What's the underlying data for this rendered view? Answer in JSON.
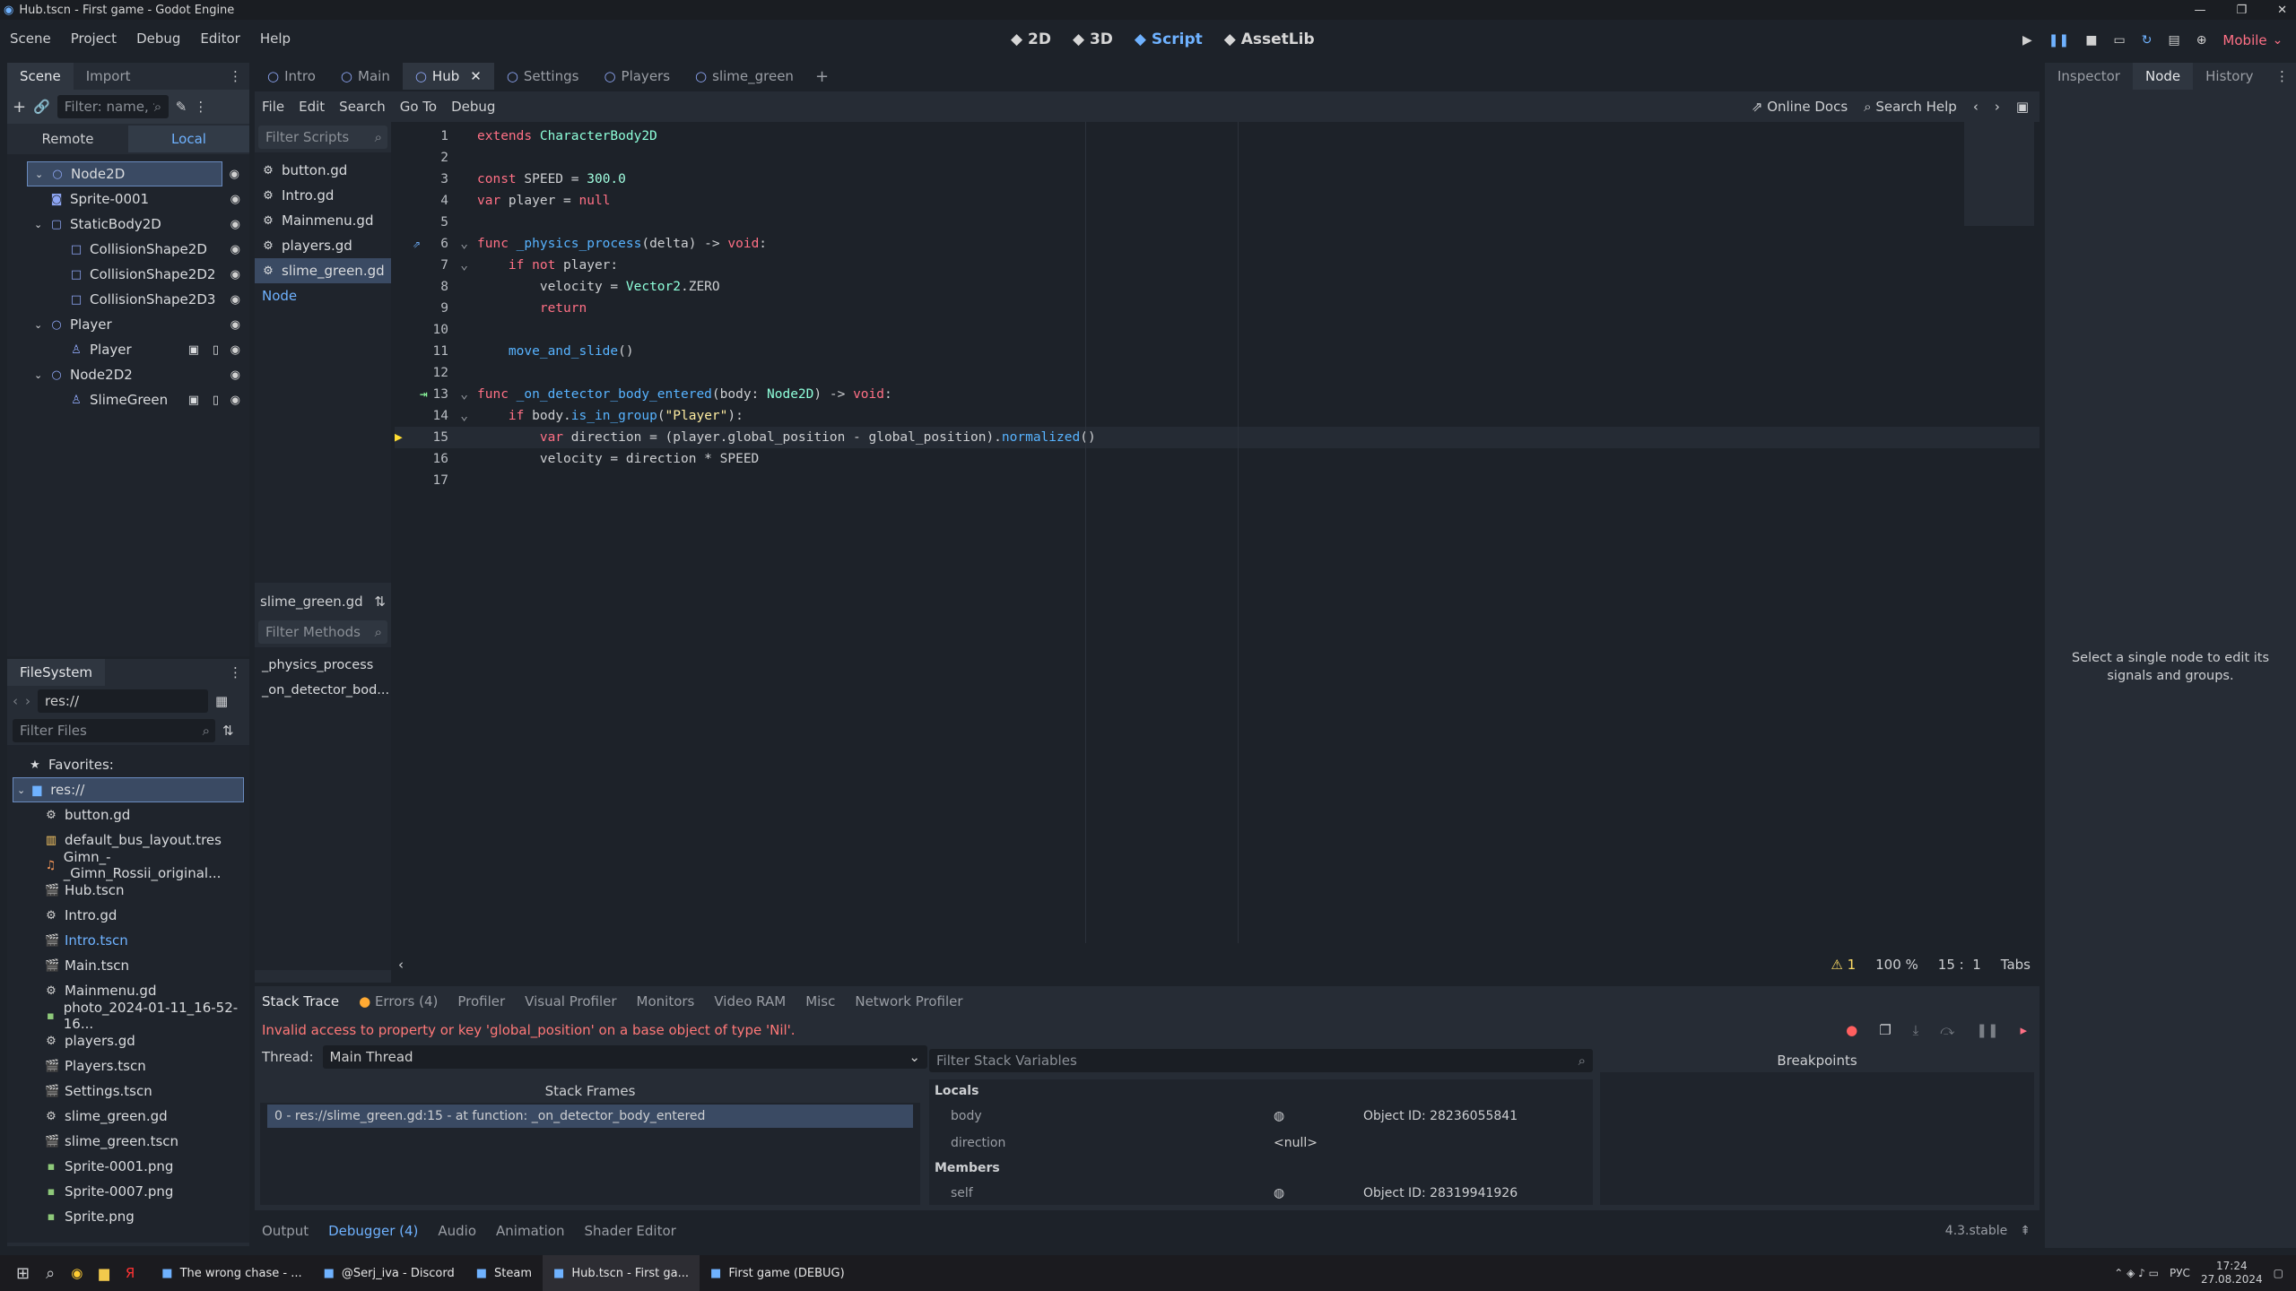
{
  "window": {
    "title": "Hub.tscn - First game - Godot Engine"
  },
  "menu": [
    "Scene",
    "Project",
    "Debug",
    "Editor",
    "Help"
  ],
  "workspaces": [
    {
      "icon": "2d-icon",
      "label": "2D"
    },
    {
      "icon": "3d-icon",
      "label": "3D"
    },
    {
      "icon": "script-icon",
      "label": "Script"
    },
    {
      "icon": "assetlib-icon",
      "label": "AssetLib"
    }
  ],
  "renderer": "Mobile",
  "scene_dock": {
    "tabs": [
      "Scene",
      "Import"
    ],
    "filter_placeholder": "Filter: name, t:t",
    "remote": "Remote",
    "local": "Local",
    "tree": [
      {
        "label": "Node2D",
        "depth": 0,
        "selected": true,
        "icon": "node2d-icon",
        "fold": true
      },
      {
        "label": "Sprite-0001",
        "depth": 1,
        "icon": "sprite-icon"
      },
      {
        "label": "StaticBody2D",
        "depth": 1,
        "icon": "staticbody-icon",
        "fold": true
      },
      {
        "label": "CollisionShape2D",
        "depth": 2,
        "icon": "collision-icon"
      },
      {
        "label": "CollisionShape2D2",
        "depth": 2,
        "icon": "collision-icon"
      },
      {
        "label": "CollisionShape2D3",
        "depth": 2,
        "icon": "collision-icon"
      },
      {
        "label": "Player",
        "depth": 1,
        "icon": "node2d-icon",
        "fold": true
      },
      {
        "label": "Player",
        "depth": 2,
        "icon": "player-icon",
        "extra": true
      },
      {
        "label": "Node2D2",
        "depth": 1,
        "icon": "node2d-icon",
        "fold": true
      },
      {
        "label": "SlimeGreen",
        "depth": 2,
        "icon": "player-icon",
        "extra": true
      }
    ]
  },
  "filesystem": {
    "title": "FileSystem",
    "path": "res://",
    "filter_placeholder": "Filter Files",
    "favorites": "Favorites:",
    "root": "res://",
    "files": [
      {
        "name": "button.gd",
        "icon": "gear-icon"
      },
      {
        "name": "default_bus_layout.tres",
        "icon": "resource-icon"
      },
      {
        "name": "Gimn_-_Gimn_Rossii_original...",
        "icon": "audio-icon"
      },
      {
        "name": "Hub.tscn",
        "icon": "scene-icon"
      },
      {
        "name": "Intro.gd",
        "icon": "gear-icon"
      },
      {
        "name": "Intro.tscn",
        "icon": "scene-icon",
        "highlight": true
      },
      {
        "name": "Main.tscn",
        "icon": "scene-icon"
      },
      {
        "name": "Mainmenu.gd",
        "icon": "gear-icon"
      },
      {
        "name": "photo_2024-01-11_16-52-16...",
        "icon": "image-icon"
      },
      {
        "name": "players.gd",
        "icon": "gear-icon"
      },
      {
        "name": "Players.tscn",
        "icon": "scene-icon"
      },
      {
        "name": "Settings.tscn",
        "icon": "scene-icon"
      },
      {
        "name": "slime_green.gd",
        "icon": "gear-icon"
      },
      {
        "name": "slime_green.tscn",
        "icon": "scene-icon"
      },
      {
        "name": "Sprite-0001.png",
        "icon": "image-icon"
      },
      {
        "name": "Sprite-0007.png",
        "icon": "image-icon"
      },
      {
        "name": "Sprite.png",
        "icon": "image-icon"
      }
    ]
  },
  "scene_tabs": [
    {
      "label": "Intro"
    },
    {
      "label": "Main"
    },
    {
      "label": "Hub",
      "active": true
    },
    {
      "label": "Settings"
    },
    {
      "label": "Players"
    },
    {
      "label": "slime_green"
    }
  ],
  "script_menu": [
    "File",
    "Edit",
    "Search",
    "Go To",
    "Debug"
  ],
  "online_docs": "Online Docs",
  "search_help": "Search Help",
  "scripts_list": {
    "filter_placeholder": "Filter Scripts",
    "items": [
      {
        "name": "button.gd"
      },
      {
        "name": "Intro.gd"
      },
      {
        "name": "Mainmenu.gd"
      },
      {
        "name": "players.gd"
      },
      {
        "name": "slime_green.gd",
        "selected": true
      },
      {
        "name": "Node",
        "link": true
      }
    ],
    "current": "slime_green.gd",
    "methods_placeholder": "Filter Methods",
    "methods": [
      "_physics_process",
      "_on_detector_bod..."
    ]
  },
  "code": [
    [
      {
        "t": "extends ",
        "c": "kw"
      },
      {
        "t": "CharacterBody2D",
        "c": "ty"
      }
    ],
    [],
    [
      {
        "t": "const ",
        "c": "kw"
      },
      {
        "t": "SPEED = "
      },
      {
        "t": "300.0",
        "c": "num"
      }
    ],
    [
      {
        "t": "var ",
        "c": "kw"
      },
      {
        "t": "player = "
      },
      {
        "t": "null",
        "c": "kw"
      }
    ],
    [],
    [
      {
        "t": "func ",
        "c": "kw"
      },
      {
        "t": "_physics_process",
        "c": "fn"
      },
      {
        "t": "(delta) -> "
      },
      {
        "t": "void",
        "c": "kw"
      },
      {
        "t": ":"
      }
    ],
    [
      {
        "t": "    "
      },
      {
        "t": "if not ",
        "c": "kw"
      },
      {
        "t": "player:"
      }
    ],
    [
      {
        "t": "        "
      },
      {
        "t": "velocity = "
      },
      {
        "t": "Vector2",
        "c": "ty"
      },
      {
        "t": ".ZERO"
      }
    ],
    [
      {
        "t": "        "
      },
      {
        "t": "return",
        "c": "kw"
      }
    ],
    [],
    [
      {
        "t": "    "
      },
      {
        "t": "move_and_slide",
        "c": "fn"
      },
      {
        "t": "()"
      }
    ],
    [],
    [
      {
        "t": "func ",
        "c": "kw"
      },
      {
        "t": "_on_detector_body_entered",
        "c": "fn"
      },
      {
        "t": "(body: "
      },
      {
        "t": "Node2D",
        "c": "ty"
      },
      {
        "t": ") -> "
      },
      {
        "t": "void",
        "c": "kw"
      },
      {
        "t": ":"
      }
    ],
    [
      {
        "t": "    "
      },
      {
        "t": "if ",
        "c": "kw"
      },
      {
        "t": "body."
      },
      {
        "t": "is_in_group",
        "c": "fn"
      },
      {
        "t": "("
      },
      {
        "t": "\"Player\"",
        "c": "str"
      },
      {
        "t": "):"
      }
    ],
    [
      {
        "t": "        "
      },
      {
        "t": "var ",
        "c": "kw"
      },
      {
        "t": "direction = (player.global_position - global_position)."
      },
      {
        "t": "normalized",
        "c": "fn"
      },
      {
        "t": "()"
      }
    ],
    [
      {
        "t": "        "
      },
      {
        "t": "velocity = direction * SPEED"
      }
    ],
    []
  ],
  "status": {
    "warnings": "1",
    "zoom": "100 %",
    "line": "15",
    "col": "1",
    "indent": "Tabs"
  },
  "debugger": {
    "tabs": [
      "Stack Trace",
      "Errors (4)",
      "Profiler",
      "Visual Profiler",
      "Monitors",
      "Video RAM",
      "Misc",
      "Network Profiler"
    ],
    "error": "Invalid access to property or key 'global_position' on a base object of type 'Nil'.",
    "thread_label": "Thread:",
    "thread": "Main Thread",
    "stack_title": "Stack Frames",
    "frame": "0 - res://slime_green.gd:15 - at function: _on_detector_body_entered",
    "filter_vars": "Filter Stack Variables",
    "breakpoints": "Breakpoints",
    "locals": "Locals",
    "members": "Members",
    "vars": [
      {
        "name": "body",
        "value": "Object ID: 28236055841",
        "obj": true
      },
      {
        "name": "direction",
        "value": "<null>"
      }
    ],
    "member_vars": [
      {
        "name": "self",
        "value": "Object ID: 28319941926",
        "obj": true
      }
    ]
  },
  "bottom_tabs": [
    "Output",
    "Debugger (4)",
    "Audio",
    "Animation",
    "Shader Editor"
  ],
  "version": "4.3.stable",
  "right_dock": {
    "tabs": [
      "Inspector",
      "Node",
      "History"
    ],
    "message": "Select a single node to edit its signals and groups."
  },
  "taskbar": {
    "items": [
      "The wrong chase - ...",
      "@Serj_iva - Discord",
      "Steam",
      "Hub.tscn - First ga...",
      "First game (DEBUG)"
    ],
    "lang": "РУС",
    "time": "17:24",
    "date": "27.08.2024"
  }
}
